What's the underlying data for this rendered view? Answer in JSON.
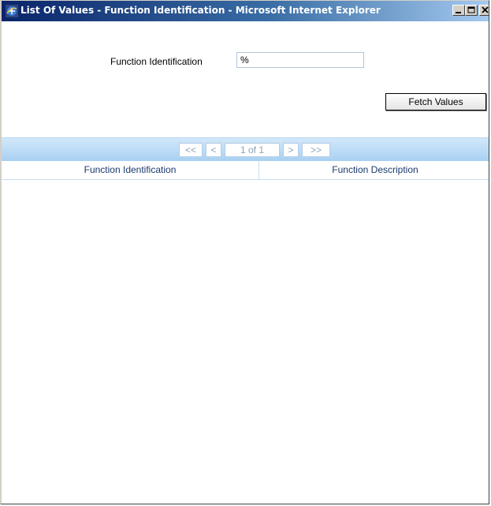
{
  "window": {
    "title": "List Of Values - Function Identification - Microsoft Internet Explorer",
    "minimize_label": "minimize",
    "maximize_label": "maximize",
    "close_label": "close"
  },
  "form": {
    "field_label": "Function Identification",
    "field_value": "%",
    "fetch_label": "Fetch Values"
  },
  "pager": {
    "first": "<<",
    "prev": "<",
    "info": "1 of 1",
    "next": ">",
    "last": ">>"
  },
  "table": {
    "columns": [
      "Function Identification",
      "Function Description"
    ],
    "rows": []
  },
  "icons": {
    "app": "internet-explorer-icon",
    "minimize": "minimize-icon",
    "maximize": "maximize-icon",
    "close": "close-icon"
  },
  "colors": {
    "titlebar_start": "#0a246a",
    "titlebar_end": "#a6caf0",
    "pager_bar": "#a9d0f2",
    "header_text": "#1a3a6c"
  }
}
